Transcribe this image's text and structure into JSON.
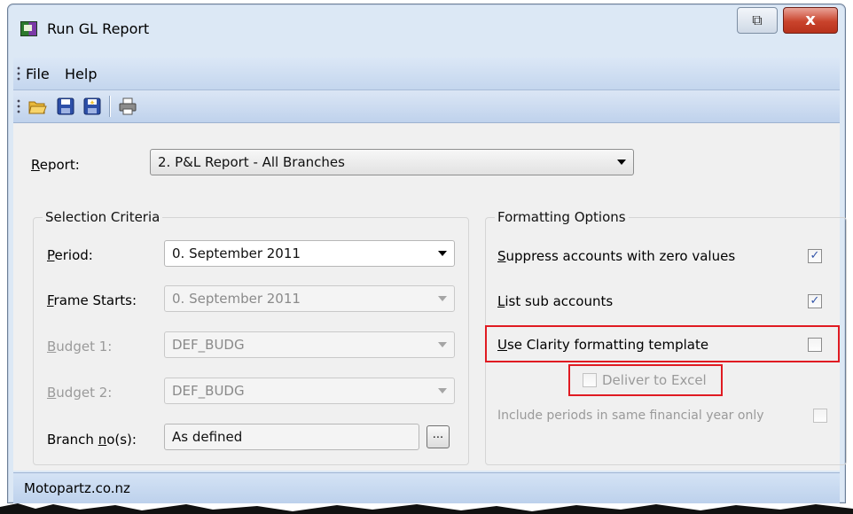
{
  "window": {
    "title": "Run GL Report",
    "restore_glyph": "⧉",
    "close_glyph": "x"
  },
  "menu": {
    "items": [
      "File",
      "Help"
    ]
  },
  "toolbar": {
    "icons": [
      "open-folder-icon",
      "save-icon",
      "save-as-icon",
      "print-icon"
    ]
  },
  "report": {
    "label_hot": "R",
    "label_rest": "eport:",
    "value": "2. P&L Report - All Branches"
  },
  "selection": {
    "title": "Selection Criteria",
    "period": {
      "label_hot": "P",
      "label_rest": "eriod:",
      "value": "0. September 2011"
    },
    "frame_starts": {
      "label_hot": "F",
      "label_rest": "rame Starts:",
      "value": "0. September 2011"
    },
    "budget1": {
      "label_hot": "B",
      "label_rest": "udget 1:",
      "value": "DEF_BUDG"
    },
    "budget2": {
      "label_hot": "B",
      "label_rest": "udget 2:",
      "value": "DEF_BUDG"
    },
    "branch": {
      "label_pre": "Branch ",
      "label_hot": "n",
      "label_rest": "o(s):",
      "value": "As defined",
      "button": "..."
    }
  },
  "formatting": {
    "title": "Formatting Options",
    "suppress": {
      "label_hot": "S",
      "label_rest": "uppress accounts with zero values",
      "checked": true
    },
    "list_sub": {
      "label_hot": "L",
      "label_rest": "ist sub accounts",
      "checked": true
    },
    "clarity": {
      "label_hot": "U",
      "label_rest": "se Clarity formatting template",
      "checked": false
    },
    "excel": {
      "label": "Deliver to Excel",
      "checked": false
    },
    "periods": {
      "label": "Include periods in same financial year only",
      "checked": false
    }
  },
  "status": {
    "text": "Motopartz.co.nz"
  },
  "colors": {
    "highlight": "#e01b22",
    "check_mark": "#3254a8"
  }
}
